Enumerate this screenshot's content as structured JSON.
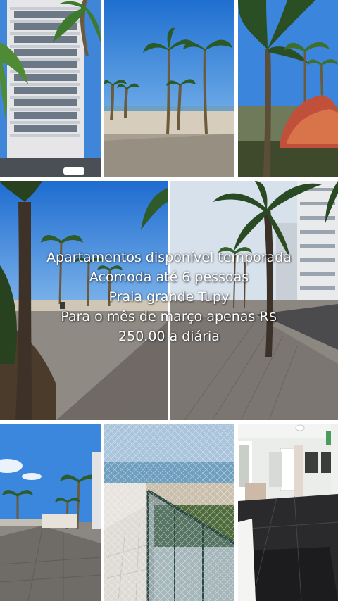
{
  "overlay_text": {
    "line1": "Apartamentos disponível temporada",
    "line2": "Acomoda até 6 pessoas",
    "line3": "Praia grande Tupy",
    "line4": "Para o mês de março apenas R$",
    "line5": "250.00 a diária"
  },
  "colors": {
    "sky": "#2f7fd6",
    "sand": "#d9cfc0",
    "palm": "#2f5a2a",
    "building": "#e8e8ea",
    "sea": "#7fa9c4"
  }
}
